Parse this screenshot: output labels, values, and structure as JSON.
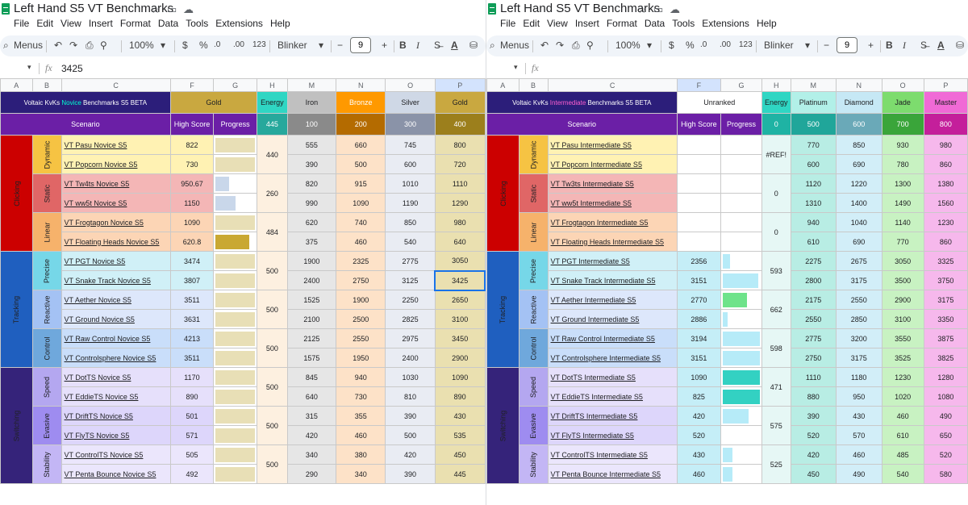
{
  "left": {
    "doc_title": "Left Hand S5 VT Benchmarks",
    "menus": [
      "File",
      "Edit",
      "View",
      "Insert",
      "Format",
      "Data",
      "Tools",
      "Extensions",
      "Help"
    ],
    "toolbar": {
      "menus_label": "Menus",
      "zoom": "100%",
      "dollar": "$",
      "percent": "%",
      "dec_less": ".0",
      "dec_more": ".00",
      "num_fmt": "123",
      "font": "Blinker",
      "font_size": "9",
      "minus": "−",
      "plus": "+",
      "bold": "B",
      "italic": "I",
      "font_color": "A"
    },
    "cell_ref": "",
    "formula_value": "3425",
    "fx": "fx",
    "col_letters": [
      "A",
      "B",
      "C",
      "F",
      "G",
      "H",
      "M",
      "N",
      "O",
      "P"
    ],
    "header1": {
      "title_prefix": "Voltaic KvKs ",
      "title_rank": "Novice",
      "title_suffix": " Benchmarks S5 BETA",
      "current_rank": "Gold",
      "energy": "Energy",
      "ranks": [
        "Iron",
        "Bronze",
        "Silver",
        "Gold"
      ]
    },
    "header2": {
      "scenario": "Scenario",
      "high_score": "High Score",
      "progress": "Progress",
      "energy_val": "445",
      "thresholds": [
        "100",
        "200",
        "300",
        "400"
      ]
    },
    "groups": [
      {
        "name": "Clicking",
        "subs": [
          {
            "name": "Dynamic",
            "energy": "440",
            "rows": [
              {
                "scenario": "VT Pasu Novice S5",
                "score": "822",
                "progress": 1,
                "vals": [
                  "555",
                  "660",
                  "745",
                  "800"
                ]
              },
              {
                "scenario": "VT Popcorn Novice S5",
                "score": "730",
                "progress": 1,
                "vals": [
                  "390",
                  "500",
                  "600",
                  "720"
                ]
              }
            ]
          },
          {
            "name": "Static",
            "energy": "260",
            "rows": [
              {
                "scenario": "VT Tw4ts Novice S5",
                "score": "950.67",
                "progress": 0.35,
                "vals": [
                  "820",
                  "915",
                  "1010",
                  "1110"
                ]
              },
              {
                "scenario": "VT ww5t Novice S5",
                "score": "1150",
                "progress": 0.5,
                "vals": [
                  "990",
                  "1090",
                  "1190",
                  "1290"
                ]
              }
            ]
          },
          {
            "name": "Linear",
            "energy": "484",
            "rows": [
              {
                "scenario": "VT Frogtagon Novice S5",
                "score": "1090",
                "progress": 1,
                "vals": [
                  "620",
                  "740",
                  "850",
                  "980"
                ]
              },
              {
                "scenario": "VT Floating Heads Novice S5",
                "score": "620.8",
                "progress": 0.85,
                "vals": [
                  "375",
                  "460",
                  "540",
                  "640"
                ]
              }
            ]
          }
        ]
      },
      {
        "name": "Tracking",
        "subs": [
          {
            "name": "Precise",
            "energy": "500",
            "rows": [
              {
                "scenario": "VT PGT Novice S5",
                "score": "3474",
                "progress": 1,
                "vals": [
                  "1900",
                  "2325",
                  "2775",
                  "3050"
                ]
              },
              {
                "scenario": "VT Snake Track Novice S5",
                "score": "3807",
                "progress": 1,
                "vals": [
                  "2400",
                  "2750",
                  "3125",
                  "3425"
                ]
              }
            ]
          },
          {
            "name": "Reactive",
            "energy": "500",
            "rows": [
              {
                "scenario": "VT Aether Novice S5",
                "score": "3511",
                "progress": 1,
                "vals": [
                  "1525",
                  "1900",
                  "2250",
                  "2650"
                ]
              },
              {
                "scenario": "VT Ground Novice S5",
                "score": "3631",
                "progress": 1,
                "vals": [
                  "2100",
                  "2500",
                  "2825",
                  "3100"
                ]
              }
            ]
          },
          {
            "name": "Control",
            "energy": "500",
            "rows": [
              {
                "scenario": "VT Raw Control Novice S5",
                "score": "4213",
                "progress": 1,
                "vals": [
                  "2125",
                  "2550",
                  "2975",
                  "3450"
                ]
              },
              {
                "scenario": "VT Controlsphere Novice S5",
                "score": "3511",
                "progress": 1,
                "vals": [
                  "1575",
                  "1950",
                  "2400",
                  "2900"
                ]
              }
            ]
          }
        ]
      },
      {
        "name": "Switching",
        "subs": [
          {
            "name": "Speed",
            "energy": "500",
            "rows": [
              {
                "scenario": "VT DotTS Novice S5",
                "score": "1170",
                "progress": 1,
                "vals": [
                  "845",
                  "940",
                  "1030",
                  "1090"
                ]
              },
              {
                "scenario": "VT EddieTS Novice S5",
                "score": "890",
                "progress": 1,
                "vals": [
                  "640",
                  "730",
                  "810",
                  "890"
                ]
              }
            ]
          },
          {
            "name": "Evasive",
            "energy": "500",
            "rows": [
              {
                "scenario": "VT DriftTS Novice S5",
                "score": "501",
                "progress": 1,
                "vals": [
                  "315",
                  "355",
                  "390",
                  "430"
                ]
              },
              {
                "scenario": "VT FlyTS Novice S5",
                "score": "571",
                "progress": 1,
                "vals": [
                  "420",
                  "460",
                  "500",
                  "535"
                ]
              }
            ]
          },
          {
            "name": "Stability",
            "energy": "500",
            "rows": [
              {
                "scenario": "VT ControlTS Novice S5",
                "score": "505",
                "progress": 1,
                "vals": [
                  "340",
                  "380",
                  "420",
                  "450"
                ]
              },
              {
                "scenario": "VT Penta Bounce Novice S5",
                "score": "492",
                "progress": 1,
                "vals": [
                  "290",
                  "340",
                  "390",
                  "445"
                ]
              }
            ]
          }
        ]
      }
    ]
  },
  "right": {
    "doc_title": "Left Hand S5 VT Benchmarks",
    "menus": [
      "File",
      "Edit",
      "View",
      "Insert",
      "Format",
      "Data",
      "Tools",
      "Extensions",
      "Help"
    ],
    "toolbar": {
      "menus_label": "Menus",
      "zoom": "100%",
      "dollar": "$",
      "percent": "%",
      "dec_less": ".0",
      "dec_more": ".00",
      "num_fmt": "123",
      "font": "Blinker",
      "font_size": "9",
      "minus": "−",
      "plus": "+",
      "bold": "B",
      "italic": "I",
      "font_color": "A"
    },
    "cell_ref": "",
    "formula_value": "",
    "fx": "fx",
    "col_letters": [
      "A",
      "B",
      "C",
      "F",
      "G",
      "H",
      "M",
      "N",
      "O",
      "P"
    ],
    "header1": {
      "title_prefix": "Voltaic KvKs ",
      "title_rank": "Intermediate",
      "title_suffix": " Benchmarks S5 BETA",
      "current_rank": "Unranked",
      "energy": "Energy",
      "ranks": [
        "Platinum",
        "Diamond",
        "Jade",
        "Master"
      ]
    },
    "header2": {
      "scenario": "Scenario",
      "high_score": "High Score",
      "progress": "Progress",
      "energy_val": "0",
      "thresholds": [
        "500",
        "600",
        "700",
        "800"
      ]
    },
    "groups": [
      {
        "name": "Clicking",
        "subs": [
          {
            "name": "Dynamic",
            "energy": "#REF!",
            "rows": [
              {
                "scenario": "VT Pasu Intermediate S5",
                "score": "",
                "progress": 0,
                "vals": [
                  "770",
                  "850",
                  "930",
                  "980"
                ]
              },
              {
                "scenario": "VT Popcorn Intermediate S5",
                "score": "",
                "progress": 0,
                "vals": [
                  "600",
                  "690",
                  "780",
                  "860"
                ]
              }
            ]
          },
          {
            "name": "Static",
            "energy": "0",
            "rows": [
              {
                "scenario": "VT Tw3ts Intermediate S5",
                "score": "",
                "progress": 0,
                "vals": [
                  "1120",
                  "1220",
                  "1300",
                  "1380"
                ]
              },
              {
                "scenario": "VT ww5t Intermediate S5",
                "score": "",
                "progress": 0,
                "vals": [
                  "1310",
                  "1400",
                  "1490",
                  "1560"
                ]
              }
            ]
          },
          {
            "name": "Linear",
            "energy": "0",
            "rows": [
              {
                "scenario": "VT Frogtagon Intermediate S5",
                "score": "",
                "progress": 0,
                "vals": [
                  "940",
                  "1040",
                  "1140",
                  "1230"
                ]
              },
              {
                "scenario": "VT Floating Heads Intermediate S5",
                "score": "",
                "progress": 0,
                "vals": [
                  "610",
                  "690",
                  "770",
                  "860"
                ]
              }
            ]
          }
        ]
      },
      {
        "name": "Tracking",
        "subs": [
          {
            "name": "Precise",
            "energy": "593",
            "rows": [
              {
                "scenario": "VT PGT Intermediate S5",
                "score": "2356",
                "progress": 0.2,
                "vals": [
                  "2275",
                  "2675",
                  "3050",
                  "3325"
                ]
              },
              {
                "scenario": "VT Snake Track Intermediate S5",
                "score": "3151",
                "progress": 0.95,
                "vals": [
                  "2800",
                  "3175",
                  "3500",
                  "3750"
                ]
              }
            ]
          },
          {
            "name": "Reactive",
            "energy": "662",
            "rows": [
              {
                "scenario": "VT Aether Intermediate S5",
                "score": "2770",
                "progress": 0.65,
                "vals": [
                  "2175",
                  "2550",
                  "2900",
                  "3175"
                ]
              },
              {
                "scenario": "VT Ground Intermediate S5",
                "score": "2886",
                "progress": 0.12,
                "vals": [
                  "2550",
                  "2850",
                  "3100",
                  "3350"
                ]
              }
            ]
          },
          {
            "name": "Control",
            "energy": "598",
            "rows": [
              {
                "scenario": "VT Raw Control Intermediate S5",
                "score": "3194",
                "progress": 1,
                "vals": [
                  "2775",
                  "3200",
                  "3550",
                  "3875"
                ]
              },
              {
                "scenario": "VT Controlsphere Intermediate S5",
                "score": "3151",
                "progress": 1,
                "vals": [
                  "2750",
                  "3175",
                  "3525",
                  "3825"
                ]
              }
            ]
          }
        ]
      },
      {
        "name": "Switching",
        "subs": [
          {
            "name": "Speed",
            "energy": "471",
            "rows": [
              {
                "scenario": "VT DotTS Intermediate S5",
                "score": "1090",
                "progress": 1,
                "vals": [
                  "1110",
                  "1180",
                  "1230",
                  "1280"
                ]
              },
              {
                "scenario": "VT EddieTS Intermediate S5",
                "score": "825",
                "progress": 1,
                "vals": [
                  "880",
                  "950",
                  "1020",
                  "1080"
                ]
              }
            ]
          },
          {
            "name": "Evasive",
            "energy": "575",
            "rows": [
              {
                "scenario": "VT DriftTS Intermediate S5",
                "score": "420",
                "progress": 0.7,
                "vals": [
                  "390",
                  "430",
                  "460",
                  "490"
                ]
              },
              {
                "scenario": "VT FlyTS Intermediate S5",
                "score": "520",
                "progress": 0,
                "vals": [
                  "520",
                  "570",
                  "610",
                  "650"
                ]
              }
            ]
          },
          {
            "name": "Stability",
            "energy": "525",
            "rows": [
              {
                "scenario": "VT ControlTS Intermediate S5",
                "score": "430",
                "progress": 0.25,
                "vals": [
                  "420",
                  "460",
                  "485",
                  "520"
                ]
              },
              {
                "scenario": "VT Penta Bounce Intermediate S5",
                "score": "460",
                "progress": 0.25,
                "vals": [
                  "450",
                  "490",
                  "540",
                  "580"
                ]
              }
            ]
          }
        ]
      }
    ]
  },
  "colors": {
    "novice_accent": "#00ffd0",
    "intermediate_accent": "#ff5fd0",
    "header_purple": "#6b1fa6",
    "title_navy": "#2c1e7a",
    "group": {
      "Clicking": "#cc0000",
      "Tracking": "#1f5fbf",
      "Switching": "#35237a"
    },
    "sub_bg": {
      "Dynamic": "#f6c343",
      "Static": "#e06666",
      "Linear": "#f6b26b",
      "Precise": "#76d7e8",
      "Reactive": "#a4c2f4",
      "Control": "#6fa8dc",
      "Speed": "#b4a7f0",
      "Evasive": "#9e8cf0",
      "Stability": "#c3b6f5"
    },
    "row_bg": {
      "Dynamic": "#fff2b3",
      "Static": "#f4b6b6",
      "Linear": "#fcd5b5",
      "Precise": "#d0f0f7",
      "Reactive": "#dde7fb",
      "Control": "#c9defa",
      "Speed": "#e6e0fb",
      "Evasive": "#ddd6fb",
      "Stability": "#ebe6fc"
    },
    "left_rank_hdr": {
      "bg": [
        "#c0c0c0",
        "#ff9900",
        "#cfd8e6",
        "#c9a840"
      ],
      "thr": [
        "#8a8a8a",
        "#b46b00",
        "#8a93a8",
        "#9c7f1c"
      ],
      "cell": [
        "#e6e6e6",
        "#fde2c8",
        "#e9ecf3",
        "#eae0b0"
      ]
    },
    "right_rank_hdr": {
      "bg": [
        "#b2f0e8",
        "#c6e8f5",
        "#7ddc6e",
        "#f06ad6"
      ],
      "thr": [
        "#20a69a",
        "#6aa9b8",
        "#3aa53a",
        "#c41f9b"
      ],
      "cell": [
        "#b8ede4",
        "#d2eef8",
        "#c8f2c2",
        "#f6b8ec"
      ]
    },
    "left_progress": [
      "#e8dfb6",
      "#e8dfb6",
      "#c9d7ea",
      "#c9d7ea",
      "#e8dfb6",
      "#c9a832",
      "#e8dfb6",
      "#e8dfb6",
      "#e8dfb6",
      "#e8dfb6",
      "#e8dfb6",
      "#e8dfb6",
      "#e8dfb6",
      "#e8dfb6",
      "#e8dfb6",
      "#e8dfb6",
      "#e8dfb6",
      "#e8dfb6"
    ],
    "right_progress": [
      "",
      "",
      "",
      "",
      "",
      "",
      "#b6ebf8",
      "#b6ebf8",
      "#6ee38a",
      "#b6ebf8",
      "#b6ebf8",
      "#b6ebf8",
      "#33d1c2",
      "#33d1c2",
      "#b6ebf8",
      "",
      "#b6ebf8",
      "#b6ebf8"
    ]
  }
}
